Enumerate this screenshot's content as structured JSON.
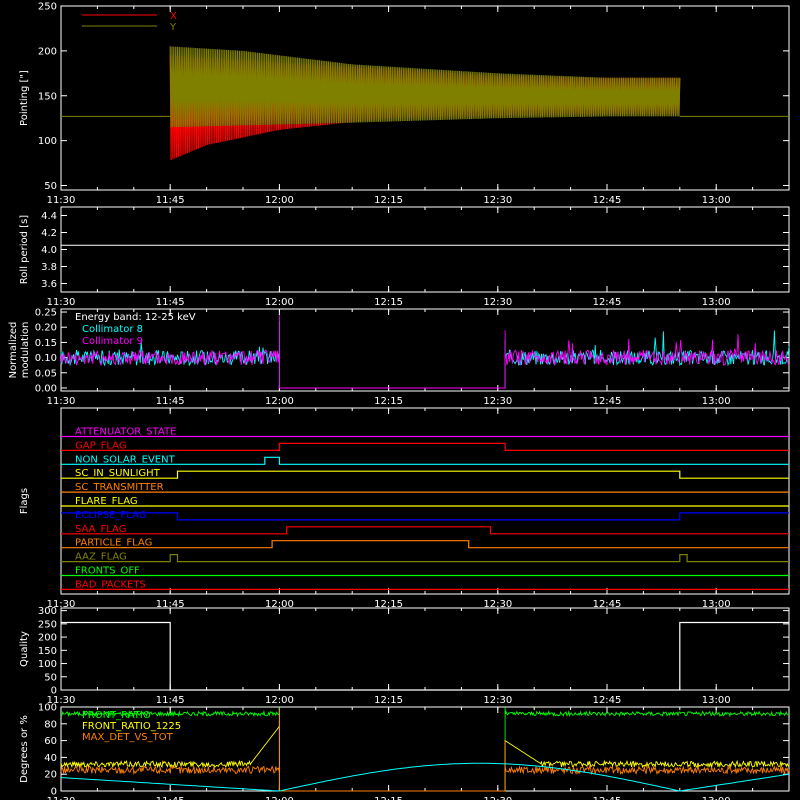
{
  "chart_data": [
    {
      "id": "pointing",
      "type": "line",
      "title": "",
      "ylabel": "Pointing [\"]",
      "ylim": [
        45,
        250
      ],
      "yticks": [
        50,
        100,
        150,
        200,
        250
      ],
      "xticks": [
        "11:30",
        "11:45",
        "12:00",
        "12:15",
        "12:30",
        "12:45",
        "13:00"
      ],
      "legend_position": "top-left",
      "reference_level": 127,
      "series": [
        {
          "name": "X",
          "color": "#ff0000",
          "start": "11:45",
          "end": "12:55",
          "upper": [
            [
              0,
              195
            ],
            [
              15,
              187
            ],
            [
              30,
              180
            ],
            [
              45,
              172
            ],
            [
              60,
              170
            ],
            [
              70,
              170
            ]
          ],
          "lower": [
            [
              0,
              78
            ],
            [
              5,
              95
            ],
            [
              15,
              112
            ],
            [
              30,
              125
            ],
            [
              45,
              128
            ],
            [
              60,
              130
            ],
            [
              70,
              130
            ]
          ]
        },
        {
          "name": "Y",
          "color": "#808000",
          "start": "11:45",
          "end": "12:55",
          "upper": [
            [
              0,
              205
            ],
            [
              10,
              200
            ],
            [
              25,
              185
            ],
            [
              45,
              175
            ],
            [
              60,
              170
            ],
            [
              70,
              170
            ]
          ],
          "lower": [
            [
              0,
              115
            ],
            [
              10,
              117
            ],
            [
              25,
              120
            ],
            [
              45,
              125
            ],
            [
              60,
              127
            ],
            [
              70,
              127
            ]
          ]
        }
      ]
    },
    {
      "id": "roll",
      "type": "line",
      "title": "",
      "ylabel": "Roll period [s]",
      "ylim": [
        3.5,
        4.5
      ],
      "yticks": [
        3.6,
        3.8,
        4.0,
        4.2,
        4.4
      ],
      "xticks": [
        "11:30",
        "11:45",
        "12:00",
        "12:15",
        "12:30",
        "12:45",
        "13:00"
      ],
      "series": [
        {
          "name": "",
          "color": "#ffffff",
          "values": [
            [
              0,
              4.05
            ],
            [
              100,
              4.05
            ]
          ]
        }
      ]
    },
    {
      "id": "modulation",
      "type": "line",
      "title": "",
      "ylabel_lines": [
        "Normalized",
        "modulation"
      ],
      "ylim": [
        -0.01,
        0.26
      ],
      "yticks": [
        0.0,
        0.05,
        0.1,
        0.15,
        0.2,
        0.25
      ],
      "xticks": [
        "11:30",
        "11:45",
        "12:00",
        "12:15",
        "12:30",
        "12:45",
        "13:00"
      ],
      "annotation": "Energy band: 12-25 keV",
      "legend_position": "top-left",
      "series": [
        {
          "name": "Collimator 8",
          "color": "#00ffff"
        },
        {
          "name": "Collimator 9",
          "color": "#ff00ff"
        }
      ],
      "segments": [
        [
          "11:30",
          "12:00"
        ],
        [
          "12:31",
          "13:10"
        ]
      ],
      "gap_level": 0.0,
      "mean_level": 0.1
    },
    {
      "id": "flags",
      "type": "line",
      "title": "",
      "ylabel": "Flags",
      "xticks": [
        "11:30",
        "11:45",
        "12:00",
        "12:15",
        "12:30",
        "12:45",
        "13:00"
      ],
      "series": [
        {
          "name": "ATTENUATOR_STATE",
          "color": "#ff00ff",
          "changes": []
        },
        {
          "name": "GAP_FLAG",
          "color": "#ff0000",
          "changes": [
            [
              "12:00",
              1
            ],
            [
              "12:31",
              0
            ]
          ]
        },
        {
          "name": "NON_SOLAR_EVENT",
          "color": "#00ffff",
          "changes": [
            [
              "11:58",
              1
            ],
            [
              "12:00",
              0
            ]
          ]
        },
        {
          "name": "SC_IN_SUNLIGHT",
          "color": "#ffff00",
          "changes": [
            [
              "11:46",
              1
            ],
            [
              "12:55",
              0
            ]
          ]
        },
        {
          "name": "SC_TRANSMITTER",
          "color": "#ff8000",
          "changes": []
        },
        {
          "name": "FLARE_FLAG",
          "color": "#ffff00",
          "changes": []
        },
        {
          "name": "ECLIPSE_FLAG",
          "color": "#0000ff",
          "start": 1,
          "changes": [
            [
              "11:46",
              0
            ],
            [
              "12:55",
              1
            ]
          ]
        },
        {
          "name": "SAA_FLAG",
          "color": "#ff0000",
          "changes": [
            [
              "12:01",
              1
            ],
            [
              "12:29",
              0
            ]
          ]
        },
        {
          "name": "PARTICLE_FLAG",
          "color": "#ff8000",
          "changes": [
            [
              "11:59",
              1
            ],
            [
              "12:26",
              0
            ]
          ]
        },
        {
          "name": "AAZ_FLAG",
          "color": "#808000",
          "changes": [
            [
              "11:45",
              1
            ],
            [
              "11:46",
              0
            ],
            [
              "12:55",
              1
            ],
            [
              "12:56",
              0
            ]
          ]
        },
        {
          "name": "FRONTS_OFF",
          "color": "#00ff00",
          "changes": []
        },
        {
          "name": "BAD_PACKETS",
          "color": "#ff0000",
          "changes": []
        }
      ]
    },
    {
      "id": "quality",
      "type": "line",
      "title": "",
      "ylabel": "Quality",
      "ylim": [
        0,
        310
      ],
      "yticks": [
        0,
        50,
        100,
        150,
        200,
        250,
        300
      ],
      "xticks": [
        "11:30",
        "11:45",
        "12:00",
        "12:15",
        "12:30",
        "12:45",
        "13:00"
      ],
      "series": [
        {
          "name": "",
          "color": "#ffffff",
          "values": [
            [
              "11:30",
              255
            ],
            [
              "11:45",
              255
            ],
            [
              "11:45",
              0
            ],
            [
              "12:55",
              0
            ],
            [
              "12:55",
              255
            ],
            [
              "13:10",
              255
            ]
          ]
        }
      ]
    },
    {
      "id": "ratios",
      "type": "line",
      "title": "",
      "ylabel": "Degrees or %",
      "ylim": [
        0,
        100
      ],
      "yticks": [
        0,
        20,
        40,
        60,
        80,
        100
      ],
      "xticks": [
        "11:30",
        "11:45",
        "12:00",
        "12:15",
        "12:30",
        "12:45",
        "13:00"
      ],
      "legend_position": "top-left",
      "series": [
        {
          "name": "FRONT_RATIO",
          "color": "#00ff00",
          "level": 92
        },
        {
          "name": "FRONT_RATIO_1225",
          "color": "#ffff00",
          "level": 32
        },
        {
          "name": "MAX_DET_VS_TOT",
          "color": "#ff8000",
          "level": 25
        },
        {
          "name": "",
          "color": "#00ffff"
        }
      ],
      "segments": [
        [
          "11:30",
          "12:00"
        ],
        [
          "12:31",
          "13:10"
        ]
      ],
      "sun_angle_peak": 33,
      "sun_angle_min": [
        "12:00",
        "12:55"
      ],
      "sun_angle_max": "12:25"
    }
  ]
}
